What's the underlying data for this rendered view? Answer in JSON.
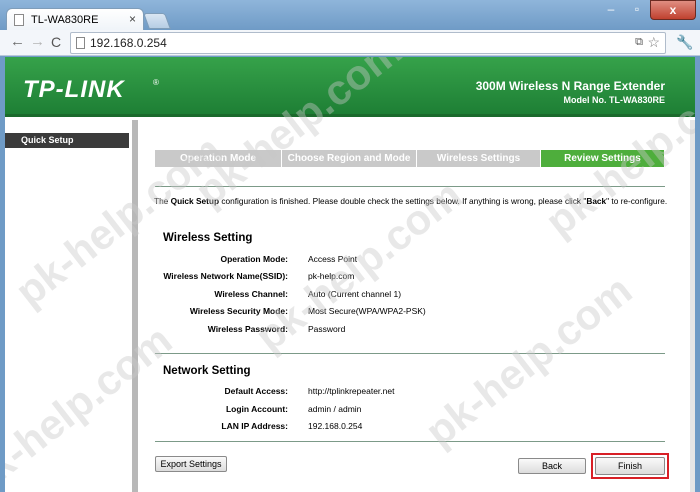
{
  "browser": {
    "tab_title": "TL-WA830RE",
    "tab_close": "×",
    "url": "192.168.0.254",
    "icons": {
      "back": "←",
      "forward": "→",
      "reload": "C",
      "star": "☆",
      "wrench": "🔧",
      "minimize": "–",
      "maximize": "▫",
      "close": "x",
      "translate": "⧉"
    }
  },
  "header": {
    "logo": "TP-LINK",
    "logo_mark": "®",
    "product": "300M Wireless N Range Extender",
    "model": "Model No. TL-WA830RE"
  },
  "sidebar": {
    "items": [
      {
        "label": "Quick Setup"
      }
    ]
  },
  "steps": [
    {
      "label": "Operation Mode",
      "active": false
    },
    {
      "label": "Choose Region and Mode",
      "active": false
    },
    {
      "label": "Wireless Settings",
      "active": false
    },
    {
      "label": "Review Settings",
      "active": true
    }
  ],
  "intro": {
    "part1": "The ",
    "bold1": "Quick Setup",
    "part2": " configuration is finished. Please double check the settings below. If anything is wrong, please click \"",
    "bold2": "Back",
    "part3": "\" to re-configure."
  },
  "wireless": {
    "title": "Wireless Setting",
    "rows": [
      {
        "label": "Operation Mode:",
        "value": "Access Point"
      },
      {
        "label": "Wireless Network Name(SSID):",
        "value": "pk-help.com"
      },
      {
        "label": "Wireless Channel:",
        "value": "Auto (Current channel 1)"
      },
      {
        "label": "Wireless Security Mode:",
        "value": "Most Secure(WPA/WPA2-PSK)"
      },
      {
        "label": "Wireless Password:",
        "value": "Password"
      }
    ]
  },
  "network": {
    "title": "Network Setting",
    "rows": [
      {
        "label": "Default Access:",
        "value": "http://tplinkrepeater.net"
      },
      {
        "label": "Login Account:",
        "value": "admin  /  admin"
      },
      {
        "label": "LAN IP Address:",
        "value": "192.168.0.254"
      }
    ]
  },
  "buttons": {
    "export": "Export Settings",
    "back": "Back",
    "finish": "Finish"
  },
  "colors": {
    "brand_green": "#2a9140",
    "step_active": "#4eae3c",
    "step_inactive": "#c9c9c9",
    "highlight_ring": "#d81f26"
  },
  "watermark": "pk-help.com"
}
